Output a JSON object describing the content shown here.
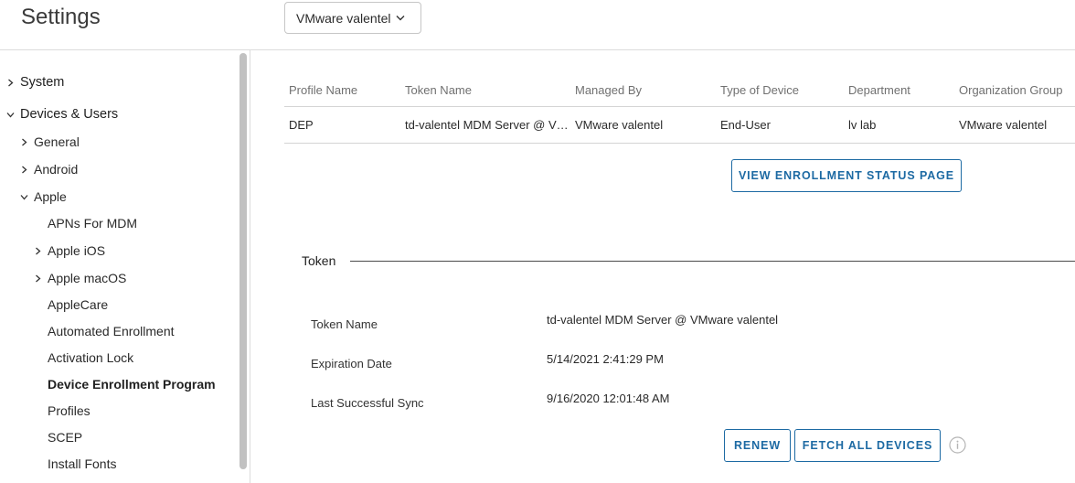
{
  "header": {
    "title": "Settings",
    "org_selector": {
      "value": "VMware valentel"
    }
  },
  "sidebar": {
    "items": [
      {
        "label": "System",
        "level": 0,
        "chevron": "right"
      },
      {
        "label": "Devices & Users",
        "level": 0,
        "chevron": "down"
      },
      {
        "label": "General",
        "level": 1,
        "chevron": "right"
      },
      {
        "label": "Android",
        "level": 1,
        "chevron": "right"
      },
      {
        "label": "Apple",
        "level": 1,
        "chevron": "down"
      },
      {
        "label": "APNs For MDM",
        "level": 2,
        "chevron": "none"
      },
      {
        "label": "Apple iOS",
        "level": 2,
        "chevron": "right"
      },
      {
        "label": "Apple macOS",
        "level": 2,
        "chevron": "right"
      },
      {
        "label": "AppleCare",
        "level": 2,
        "chevron": "none"
      },
      {
        "label": "Automated Enrollment",
        "level": 2,
        "chevron": "none"
      },
      {
        "label": "Activation Lock",
        "level": 2,
        "chevron": "none"
      },
      {
        "label": "Device Enrollment Program",
        "level": 2,
        "chevron": "none",
        "active": true
      },
      {
        "label": "Profiles",
        "level": 2,
        "chevron": "none"
      },
      {
        "label": "SCEP",
        "level": 2,
        "chevron": "none"
      },
      {
        "label": "Install Fonts",
        "level": 2,
        "chevron": "none"
      }
    ]
  },
  "profiles_table": {
    "columns": [
      "Profile Name",
      "Token Name",
      "Managed By",
      "Type of Device",
      "Department",
      "Organization Group"
    ],
    "rows": [
      [
        "DEP",
        "td-valentel MDM Server @ VMware valentel",
        "VMware valentel",
        "End-User",
        "lv lab",
        "VMware valentel"
      ]
    ]
  },
  "actions": {
    "view_enrollment_status": "VIEW ENROLLMENT STATUS PAGE"
  },
  "token": {
    "section_title": "Token",
    "fields": [
      {
        "label": "Token Name",
        "value": "td-valentel MDM Server @ VMware valentel"
      },
      {
        "label": "Expiration Date",
        "value": "5/14/2021 2:41:29 PM"
      },
      {
        "label": "Last Successful Sync",
        "value": "9/16/2020 12:01:48 AM"
      }
    ],
    "renew_label": "RENEW",
    "fetch_label": "FETCH ALL DEVICES",
    "info_icon": "info-icon"
  },
  "colors": {
    "accent": "#1d6aa3",
    "border": "#d4d4d4",
    "muted_text": "#707070"
  }
}
